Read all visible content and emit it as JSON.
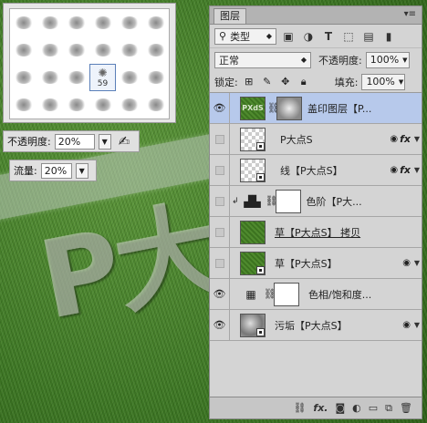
{
  "canvas": {
    "text": "P大"
  },
  "brush_picker": {
    "selected_number": "59"
  },
  "tool_options": {
    "opacity_label": "不透明度:",
    "opacity_value": "20%",
    "flow_label": "流量:",
    "flow_value": "20%"
  },
  "layers_panel": {
    "tab_title": "图层",
    "filter_type": "类型",
    "blend_mode": "正常",
    "opacity_label": "不透明度:",
    "opacity_value": "100%",
    "lock_label": "锁定:",
    "fill_label": "填充:",
    "fill_value": "100%",
    "layers": [
      {
        "name": "盖印图层【P...",
        "visible": true,
        "active": true,
        "thumb_text": "PXdS"
      },
      {
        "name": "P大点S",
        "visible": false
      },
      {
        "name": "线【P大点S】",
        "visible": false
      },
      {
        "name": "色阶【P大...",
        "visible": false
      },
      {
        "name": "草【P大点S】 拷贝",
        "visible": false
      },
      {
        "name": "草【P大点S】",
        "visible": false
      },
      {
        "name": "色相/饱和度...",
        "visible": true
      },
      {
        "name": "污垢【P大点S】",
        "visible": true
      }
    ],
    "bottom_fx": "fx."
  }
}
